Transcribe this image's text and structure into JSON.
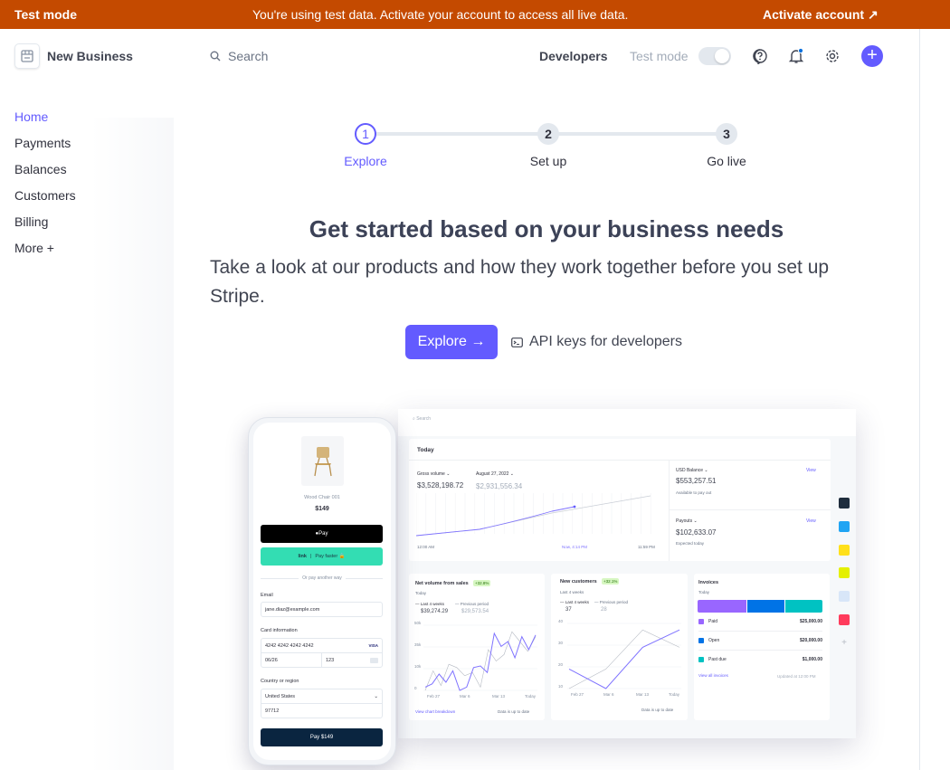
{
  "banner": {
    "label": "Test mode",
    "message": "You're using test data. Activate your account to access all live data.",
    "action": "Activate account",
    "action_icon": "arrow-up-right-icon",
    "color": "#c44a00"
  },
  "header": {
    "business": "New Business",
    "search_placeholder": "Search",
    "developers": "Developers",
    "test_mode": "Test mode",
    "test_mode_on": false,
    "icons": [
      "help-icon",
      "bell-icon",
      "gear-icon",
      "plus-icon"
    ]
  },
  "sidebar": {
    "items": [
      {
        "label": "Home",
        "active": true
      },
      {
        "label": "Payments"
      },
      {
        "label": "Balances"
      },
      {
        "label": "Customers"
      },
      {
        "label": "Billing"
      },
      {
        "label": "More +"
      }
    ]
  },
  "stepper": [
    {
      "num": "1",
      "label": "Explore",
      "active": true
    },
    {
      "num": "2",
      "label": "Set up"
    },
    {
      "num": "3",
      "label": "Go live"
    }
  ],
  "main": {
    "title": "Get started based on your business needs",
    "subtitle": "Take a look at our products and how they work together before you set up Stripe.",
    "explore_button": "Explore →",
    "api_keys": "API keys for developers",
    "accent": "#635bff"
  },
  "phone": {
    "product": "Wood Chair 001",
    "price": "$149",
    "apple_pay": " Pay",
    "link": "link",
    "link_pay": "Pay faster 🔒",
    "divider": "Or pay another way",
    "email_label": "Email",
    "email": "jane.diaz@example.com",
    "card_label": "Card information",
    "card_number": "4242 4242 4242 4242",
    "card_brand": "VISA",
    "expiry": "06/26",
    "cvc": "123",
    "country_label": "Country or region",
    "country": "United States",
    "zip": "97712",
    "pay_button": "Pay $149"
  },
  "dashboard": {
    "search": "Search",
    "today": "Today",
    "gross": {
      "label": "Gross volume ⌄",
      "value": "$3,528,198.72",
      "compare_label": "August 27, 2022 ⌄",
      "compare_value": "$2,931,556.34",
      "x_start": "12:00 AM",
      "x_now": "Now, 4:14 PM",
      "x_end": "11:59 PM"
    },
    "balance": {
      "label": "USD Balance ⌄",
      "value": "$553,257.51",
      "sub": "Available to pay out",
      "view": "View"
    },
    "payouts": {
      "label": "Payouts ⌄",
      "value": "$102,633.07",
      "sub": "Expected today",
      "view": "View"
    },
    "net_volume": {
      "title": "Net volume from sales",
      "badge": "+32.8%",
      "period": "Today",
      "legend_current": "Last 4 weeks",
      "legend_previous": "Previous period",
      "current": "$39,274.29",
      "previous": "$29,573.54",
      "y_ticks": [
        "50k",
        "35k",
        "10k",
        "0"
      ],
      "x_ticks": [
        "Feb 27",
        "Mar 6",
        "Mar 13",
        "Today"
      ],
      "footer_link": "View chart breakdown",
      "footer_status": "Data is up to date",
      "current_series": [
        2,
        4,
        10,
        5,
        12,
        0,
        2,
        14,
        15,
        11,
        35,
        27,
        30,
        20,
        33,
        25,
        34
      ],
      "previous_series": [
        0,
        12,
        3,
        16,
        14,
        9,
        11,
        2,
        25,
        18,
        22,
        36,
        30,
        24,
        33
      ]
    },
    "new_customers": {
      "title": "New customers",
      "badge": "+32.1%",
      "period": "Last 4 weeks",
      "legend_current": "Last 4 weeks",
      "legend_previous": "Previous period",
      "current": "37",
      "previous": "28",
      "y_ticks": [
        "40",
        "30",
        "20",
        "10"
      ],
      "x_ticks": [
        "Feb 27",
        "Mar 6",
        "Mar 13",
        "Today"
      ],
      "footer_status": "Data is up to date",
      "current_series": [
        19,
        10,
        29,
        37
      ],
      "previous_series": [
        10,
        19,
        37,
        29
      ]
    },
    "invoices": {
      "title": "Invoices",
      "period": "Today",
      "rows": [
        {
          "label": "Paid",
          "amount": "$25,000.00",
          "color": "#9966ff"
        },
        {
          "label": "Open",
          "amount": "$20,000.00",
          "color": "#0073e6"
        },
        {
          "label": "Past due",
          "amount": "$1,000.00",
          "color": "#00c2c2"
        }
      ],
      "footer_link": "View all invoices",
      "footer_status": "Updated at 12:00 PM"
    },
    "apps": [
      "intercom-icon",
      "hubspot-icon",
      "mailchimp-icon",
      "download-icon",
      "app-icon",
      "taskapp-icon",
      "plus-icon"
    ]
  }
}
